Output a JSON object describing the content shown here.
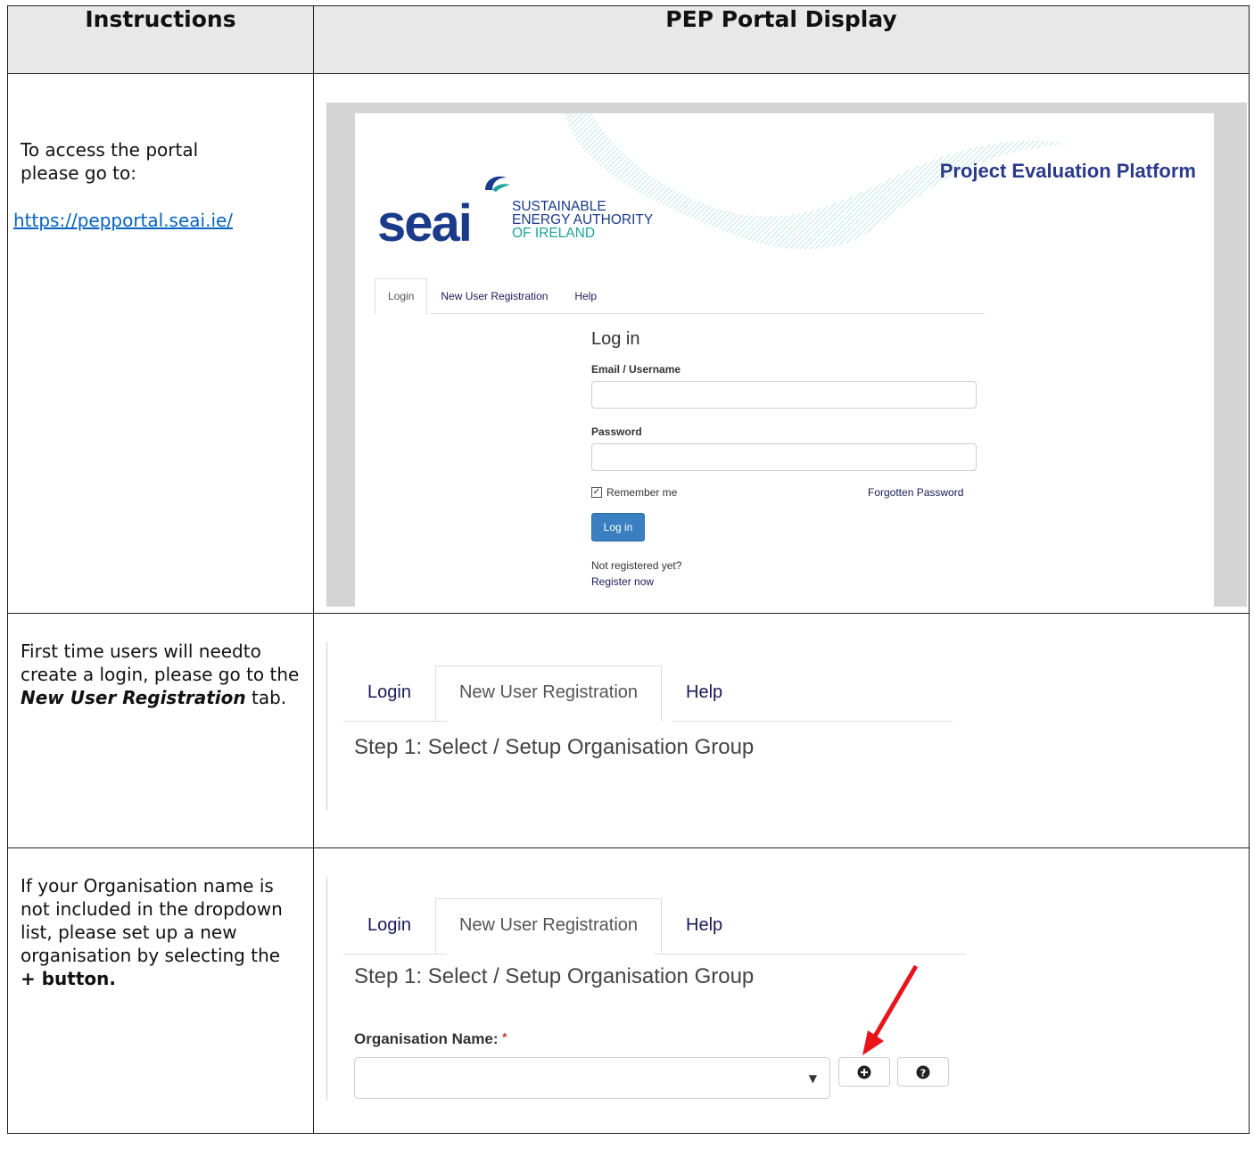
{
  "headers": {
    "instructions": "Instructions",
    "display": "PEP Portal Display"
  },
  "rows": [
    {
      "instr_lines": [
        "To access the portal",
        "please go to:"
      ],
      "link": "https://pepportal.seai.ie/"
    },
    {
      "instr_pre": "First time users will needto create a login, please go to the ",
      "instr_em": "New User Registration",
      "instr_post": " tab."
    },
    {
      "instr_pre": "If your Organisation name is not included in the dropdown list, please set up a new organisation by selecting the ",
      "instr_bold": "+ button."
    }
  ],
  "portal": {
    "title": "Project Evaluation Platform",
    "logo_text": "seai",
    "logo_sub": [
      "SUSTAINABLE",
      "ENERGY AUTHORITY",
      "OF IRELAND"
    ],
    "tabs": [
      "Login",
      "New User Registration",
      "Help"
    ],
    "login_heading": "Log in",
    "email_label": "Email / Username",
    "password_label": "Password",
    "remember_label": "Remember me",
    "forgot_label": "Forgotten Password",
    "login_button": "Log in",
    "not_registered": "Not registered yet?",
    "register_now": "Register now",
    "step1": "Step 1: Select / Setup Organisation Group",
    "org_label": "Organisation Name:",
    "required_mark": "*"
  },
  "colors": {
    "accent_blue": "#3a7fc1",
    "brand_navy": "#1a3a8a",
    "brand_teal": "#1ba39c",
    "arrow_red": "#e8141a",
    "link_blue": "#0563c1"
  }
}
